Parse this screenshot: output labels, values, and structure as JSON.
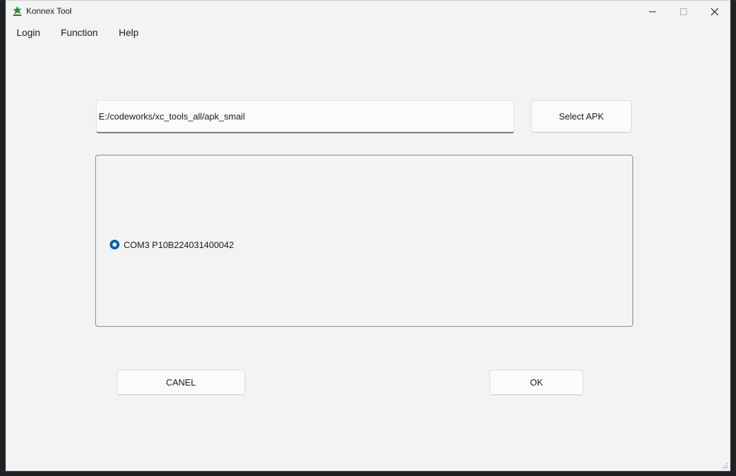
{
  "window": {
    "title": "Konnex Tool",
    "controls": {
      "minimize": "minimize",
      "maximize": "maximize",
      "close": "close"
    }
  },
  "menu": {
    "items": [
      {
        "label": "Login"
      },
      {
        "label": "Function"
      },
      {
        "label": "Help"
      }
    ]
  },
  "apk": {
    "path_value": "E:/codeworks/xc_tools_all/apk_smail",
    "select_button": "Select APK"
  },
  "devices": {
    "items": [
      {
        "label": "COM3 P10B224031400042",
        "selected": true
      }
    ]
  },
  "actions": {
    "cancel_label": "CANEL",
    "ok_label": "OK"
  },
  "colors": {
    "window_bg": "#f3f3f3",
    "radio_accent": "#0f5ea8",
    "desktop_bg": "#1e1f22"
  },
  "icons": {
    "app": "konnex-app-icon",
    "minimize": "minimize-icon",
    "maximize": "maximize-icon",
    "close": "close-icon",
    "resize": "resize-grip-icon"
  }
}
